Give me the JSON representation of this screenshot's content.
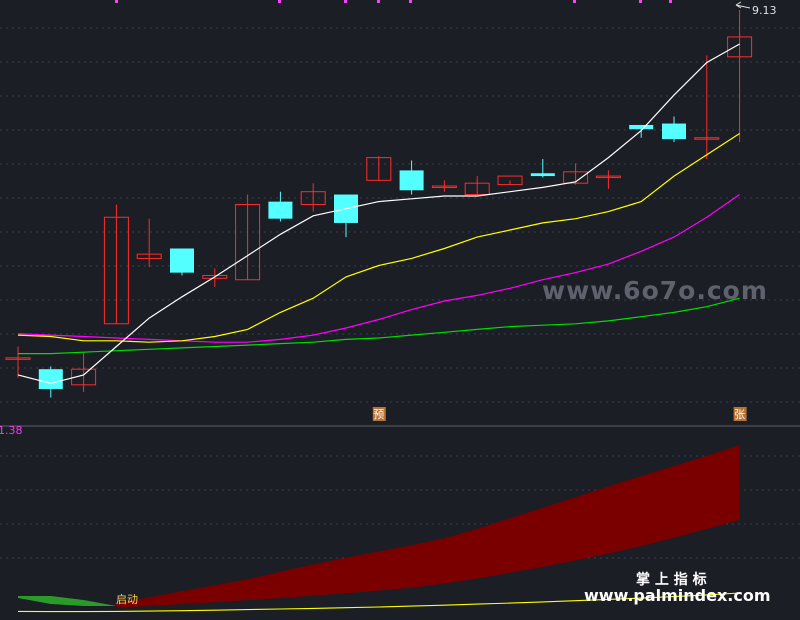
{
  "chart_data": {
    "type": "candlestick",
    "main": {
      "price_label": "9.13",
      "candles": [
        {
          "o": 7.48,
          "h": 7.56,
          "l": 7.34,
          "c": 7.48
        },
        {
          "o": 7.4,
          "h": 7.42,
          "l": 7.2,
          "c": 7.26
        },
        {
          "o": 7.29,
          "h": 7.52,
          "l": 7.24,
          "c": 7.4
        },
        {
          "o": 7.72,
          "h": 8.56,
          "l": 7.72,
          "c": 8.47
        },
        {
          "o": 8.18,
          "h": 8.46,
          "l": 8.12,
          "c": 8.21
        },
        {
          "o": 8.25,
          "h": 8.25,
          "l": 8.06,
          "c": 8.08
        },
        {
          "o": 8.04,
          "h": 8.11,
          "l": 7.98,
          "c": 8.06
        },
        {
          "o": 8.03,
          "h": 8.63,
          "l": 8.03,
          "c": 8.56
        },
        {
          "o": 8.58,
          "h": 8.65,
          "l": 8.44,
          "c": 8.46
        },
        {
          "o": 8.56,
          "h": 8.71,
          "l": 8.51,
          "c": 8.65
        },
        {
          "o": 8.63,
          "h": 8.63,
          "l": 8.33,
          "c": 8.43
        },
        {
          "o": 8.73,
          "h": 8.9,
          "l": 8.73,
          "c": 8.89
        },
        {
          "o": 8.8,
          "h": 8.87,
          "l": 8.63,
          "c": 8.66
        },
        {
          "o": 8.69,
          "h": 8.73,
          "l": 8.65,
          "c": 8.69
        },
        {
          "o": 8.63,
          "h": 8.76,
          "l": 8.63,
          "c": 8.71
        },
        {
          "o": 8.7,
          "h": 8.73,
          "l": 8.7,
          "c": 8.76
        },
        {
          "o": 8.78,
          "h": 8.88,
          "l": 8.75,
          "c": 8.76
        },
        {
          "o": 8.71,
          "h": 8.85,
          "l": 8.7,
          "c": 8.79
        },
        {
          "o": 8.75,
          "h": 8.8,
          "l": 8.67,
          "c": 8.76
        },
        {
          "o": 9.12,
          "h": 9.12,
          "l": 9.03,
          "c": 9.09
        },
        {
          "o": 9.13,
          "h": 9.18,
          "l": 9.0,
          "c": 9.02
        },
        {
          "o": 9.03,
          "h": 9.61,
          "l": 8.88,
          "c": 9.03
        },
        {
          "o": 9.6,
          "h": 9.93,
          "l": 9.0,
          "c": 9.74
        }
      ],
      "ma_white": [
        7.36,
        7.3,
        7.36,
        7.56,
        7.76,
        7.91,
        8.05,
        8.2,
        8.35,
        8.48,
        8.53,
        8.58,
        8.6,
        8.62,
        8.62,
        8.65,
        8.68,
        8.72,
        8.89,
        9.08,
        9.33,
        9.56,
        9.69
      ],
      "ma_yellow": [
        7.64,
        7.63,
        7.6,
        7.6,
        7.59,
        7.6,
        7.63,
        7.68,
        7.8,
        7.9,
        8.05,
        8.13,
        8.18,
        8.25,
        8.33,
        8.38,
        8.43,
        8.46,
        8.51,
        8.58,
        8.76,
        8.91,
        9.06
      ],
      "ma_magenta": [
        7.65,
        7.64,
        7.63,
        7.62,
        7.61,
        7.6,
        7.59,
        7.59,
        7.61,
        7.64,
        7.69,
        7.75,
        7.82,
        7.88,
        7.92,
        7.97,
        8.03,
        8.08,
        8.14,
        8.23,
        8.33,
        8.47,
        8.63
      ],
      "ma_green": [
        7.51,
        7.51,
        7.52,
        7.53,
        7.54,
        7.55,
        7.56,
        7.57,
        7.58,
        7.59,
        7.61,
        7.62,
        7.64,
        7.66,
        7.68,
        7.7,
        7.71,
        7.72,
        7.74,
        7.77,
        7.8,
        7.84,
        7.9
      ],
      "markers": [
        {
          "index": 11,
          "text": "预"
        },
        {
          "index": 22,
          "text": "张"
        }
      ]
    },
    "sub": {
      "label": "1.38",
      "band_top": [
        0.5,
        0.92,
        1.55,
        3.0,
        5.0,
        7.0,
        9.0,
        11.0,
        13.6,
        16.0,
        18.3,
        20.4,
        22.5,
        24.8,
        28.0,
        31.6,
        35.1,
        38.7,
        42.3,
        45.8,
        49.2,
        52.6,
        56.2
      ],
      "band_bottom": [
        0.5,
        0.92,
        1.55,
        1.55,
        2.0,
        2.65,
        3.3,
        4.0,
        4.7,
        5.5,
        6.3,
        7.2,
        8.2,
        9.6,
        11.3,
        13.2,
        15.2,
        17.4,
        19.7,
        22.2,
        25.0,
        28.0,
        31.0
      ],
      "yellow_line": [
        0.2,
        0.15,
        0.12,
        0.2,
        0.3,
        0.45,
        0.6,
        0.8,
        1.0,
        1.2,
        1.45,
        1.7,
        2.0,
        2.3,
        2.65,
        3.0,
        3.4,
        3.8,
        4.25,
        4.7,
        5.2,
        5.75,
        6.4
      ],
      "start_label": "启动"
    }
  },
  "watermarks": {
    "upper": "www.6o7o.com",
    "lower_title": "掌 上 指 标",
    "lower_url": "www.palmindex.com"
  },
  "colors": {
    "bg": "#1b1e25",
    "up": "#ff2b2b",
    "down": "#54ffff",
    "ma_white": "#ffffff",
    "ma_yellow": "#ffff00",
    "ma_magenta": "#ff00ff",
    "ma_green": "#00dd00",
    "band": "#7a0000",
    "band_green": "#2a9a2a",
    "marker_bg": "#b87333"
  }
}
